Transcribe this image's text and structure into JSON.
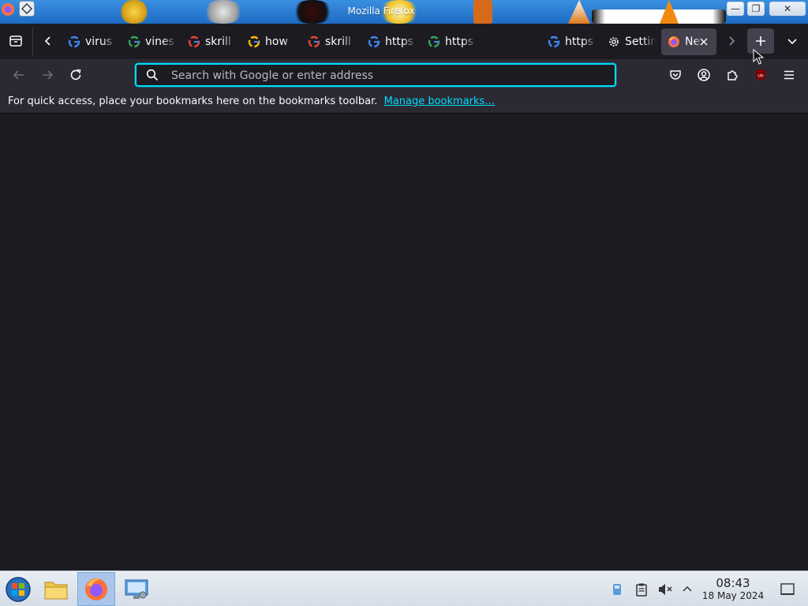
{
  "window": {
    "title": "Mozilla Firefox",
    "buttons": {
      "minimize": "—",
      "restore": "❐",
      "close": "✕"
    }
  },
  "tabs": [
    {
      "label": "virus",
      "icon": "google-icon"
    },
    {
      "label": "vines",
      "icon": "google-icon"
    },
    {
      "label": "skrill",
      "icon": "google-icon"
    },
    {
      "label": "how",
      "icon": "google-icon"
    },
    {
      "label": "skrill",
      "icon": "google-icon"
    },
    {
      "label": "https",
      "icon": "google-icon"
    },
    {
      "label": "https",
      "icon": "google-icon"
    },
    {
      "label": "https",
      "icon": "google-icon"
    },
    {
      "label": "Settings",
      "icon": "gear-icon"
    },
    {
      "label": "New Tab",
      "icon": "firefox-icon",
      "selected": true
    }
  ],
  "navbar": {
    "urlbar_placeholder": "Search with Google or enter address",
    "urlbar_value": ""
  },
  "bookmarks_bar": {
    "message": "For quick access, place your bookmarks here on the bookmarks toolbar.",
    "link": "Manage bookmarks…"
  },
  "taskbar": {
    "clock_time": "08:43",
    "clock_date": "18 May 2024"
  },
  "colors": {
    "accent": "#00ddff",
    "toolbar": "#2b2a33",
    "background": "#1c1b22"
  }
}
